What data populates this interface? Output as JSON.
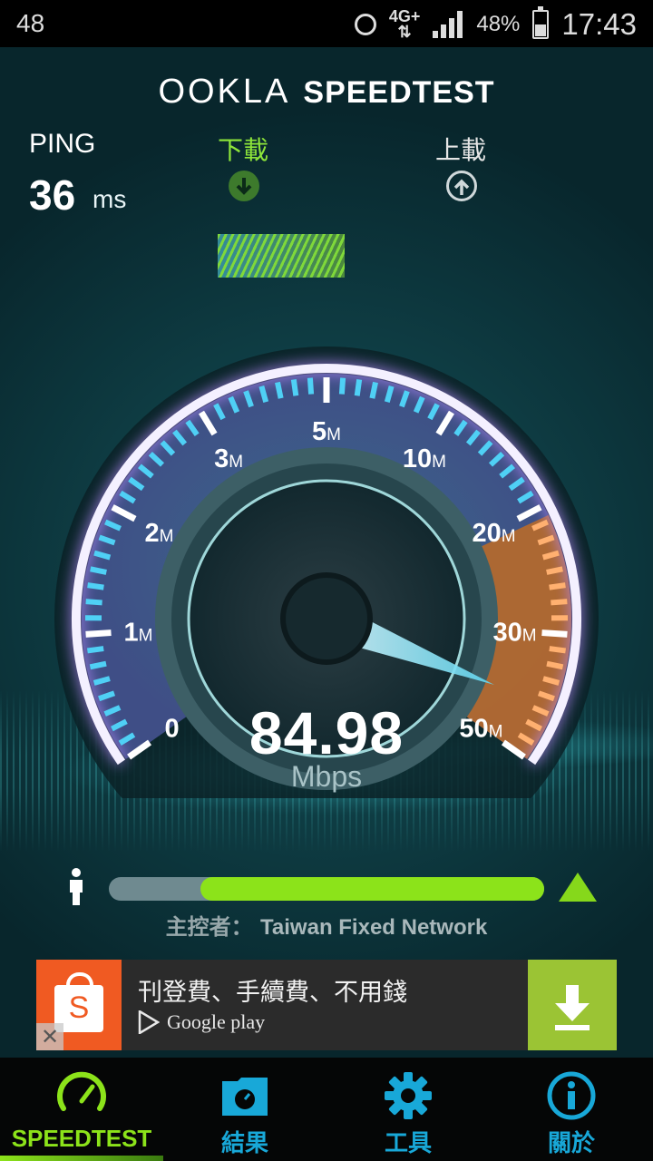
{
  "status_bar": {
    "left_text": "48",
    "network": "4G+",
    "battery": "48%",
    "battery_level": 0.48,
    "time": "17:43",
    "icons": [
      "alarm-icon",
      "signal-icon",
      "battery-icon"
    ]
  },
  "header": {
    "brand": "OOKLA",
    "product": "SPEEDTEST"
  },
  "ping": {
    "label": "PING",
    "value": "36",
    "unit": "ms"
  },
  "download": {
    "label": "下載",
    "icon": "arrow-down-circle-icon",
    "color": "#8ee63a"
  },
  "upload": {
    "label": "上載",
    "icon": "arrow-up-circle-icon"
  },
  "gauge": {
    "ticks": [
      {
        "n": "0",
        "u": ""
      },
      {
        "n": "1",
        "u": "M"
      },
      {
        "n": "2",
        "u": "M"
      },
      {
        "n": "3",
        "u": "M"
      },
      {
        "n": "5",
        "u": "M"
      },
      {
        "n": "10",
        "u": "M"
      },
      {
        "n": "20",
        "u": "M"
      },
      {
        "n": "30",
        "u": "M"
      },
      {
        "n": "50",
        "u": "M"
      }
    ],
    "speed": "84.98",
    "unit": "Mbps",
    "accent": "#b86a2a"
  },
  "signal": {
    "level": 0.79,
    "host_label": "主控者：",
    "host_name": "Taiwan Fixed Network"
  },
  "ad": {
    "title": "刊登費、手續費、不用錢",
    "store": "Google play",
    "app_icon_letter": "S",
    "close_icon": "close-icon",
    "download_icon": "download-icon"
  },
  "nav": {
    "items": [
      {
        "label": "SPEEDTEST",
        "icon": "speedometer-icon",
        "active": true
      },
      {
        "label": "結果",
        "icon": "results-folder-icon",
        "active": false
      },
      {
        "label": "工具",
        "icon": "gear-icon",
        "active": false
      },
      {
        "label": "關於",
        "icon": "info-icon",
        "active": false
      }
    ],
    "active_color": "#8ce31a",
    "inactive_color": "#18a8d8"
  }
}
